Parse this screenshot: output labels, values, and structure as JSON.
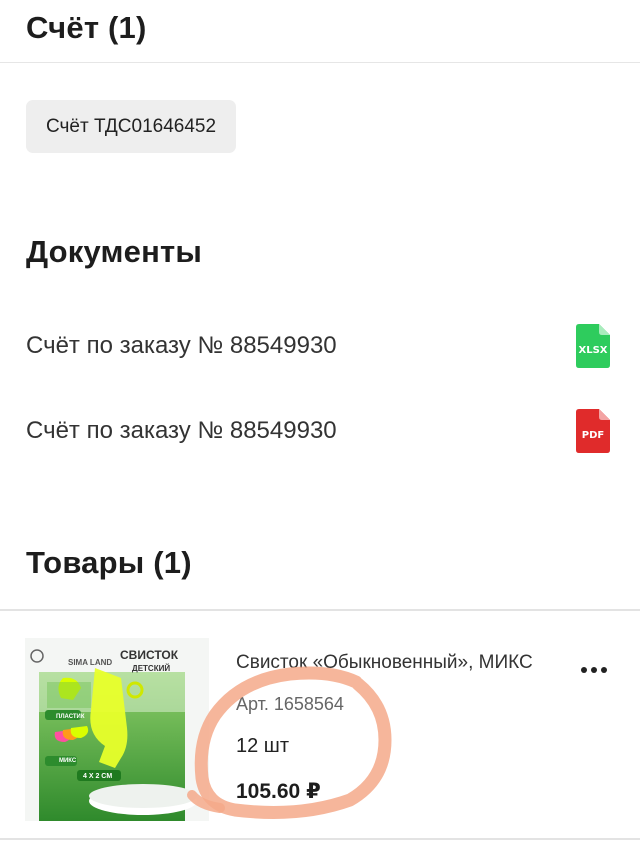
{
  "invoice_section": {
    "title": "Счёт (1)",
    "invoice_chip": "Счёт ТДС01646452"
  },
  "documents_section": {
    "title": "Документы",
    "items": [
      {
        "label": "Счёт по заказу № 88549930",
        "file_type": "XLSX",
        "icon": "xlsx-file-icon",
        "color": "#2ecc5d"
      },
      {
        "label": "Счёт по заказу № 88549930",
        "file_type": "PDF",
        "icon": "pdf-file-icon",
        "color": "#e02b2b"
      }
    ]
  },
  "goods_section": {
    "title": "Товары (1)",
    "product": {
      "name": "Свисток «Обыкновенный», МИКС",
      "article": "Арт. 1658564",
      "quantity": "12 шт",
      "price": "105.60 ₽",
      "image": {
        "brand": "SIMA LAND",
        "title": "СВИСТОК",
        "subtitle": "ДЕТСКИЙ",
        "label_plastic": "ПЛАСТИК",
        "label_mix": "МИКС",
        "dimensions": "4 X 2 CM"
      },
      "more_icon": "more-horizontal-icon"
    }
  },
  "colors": {
    "annotation_stroke": "#f4a98a",
    "chip_bg": "#eeeeee"
  }
}
